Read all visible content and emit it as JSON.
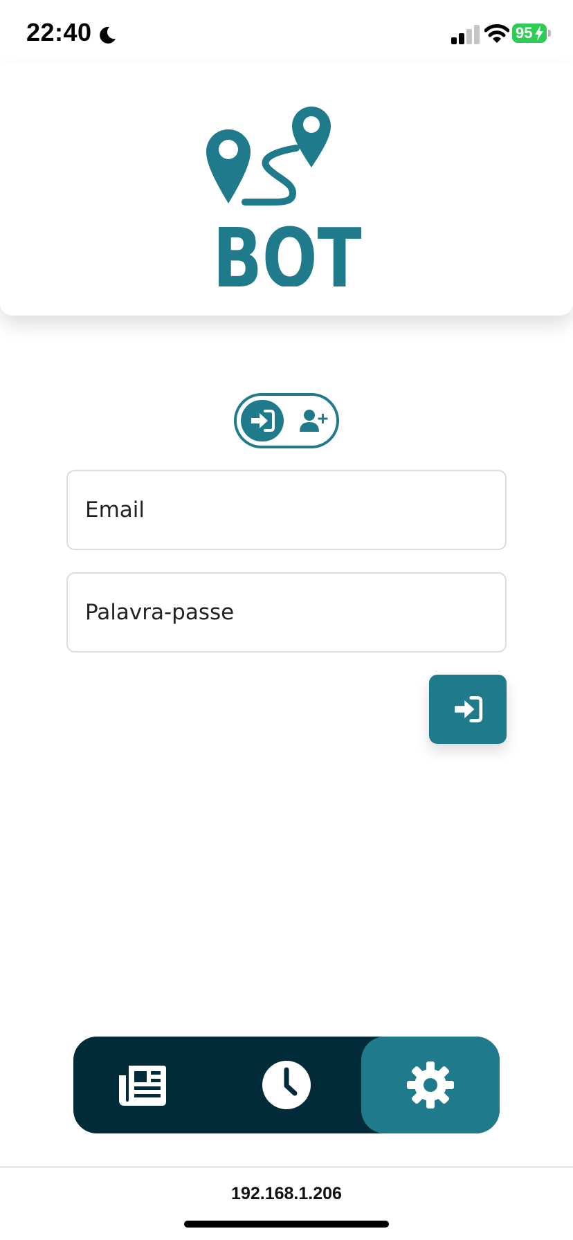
{
  "status_bar": {
    "time": "22:40",
    "battery_level": "95"
  },
  "header": {
    "logo_text": "BOT"
  },
  "auth_toggle": {
    "selected": "login",
    "options": [
      "login",
      "register"
    ]
  },
  "form": {
    "email_placeholder": "Email",
    "password_placeholder": "Palavra-passe"
  },
  "bottom_nav": {
    "items": [
      {
        "icon": "newspaper-icon"
      },
      {
        "icon": "clock-icon"
      },
      {
        "icon": "gear-icon"
      }
    ],
    "active_index": 2
  },
  "footer": {
    "address": "192.168.1.206"
  },
  "colors": {
    "primary": "#1f7a8c",
    "nav_background": "#022b3a",
    "battery": "#2fcc55"
  }
}
